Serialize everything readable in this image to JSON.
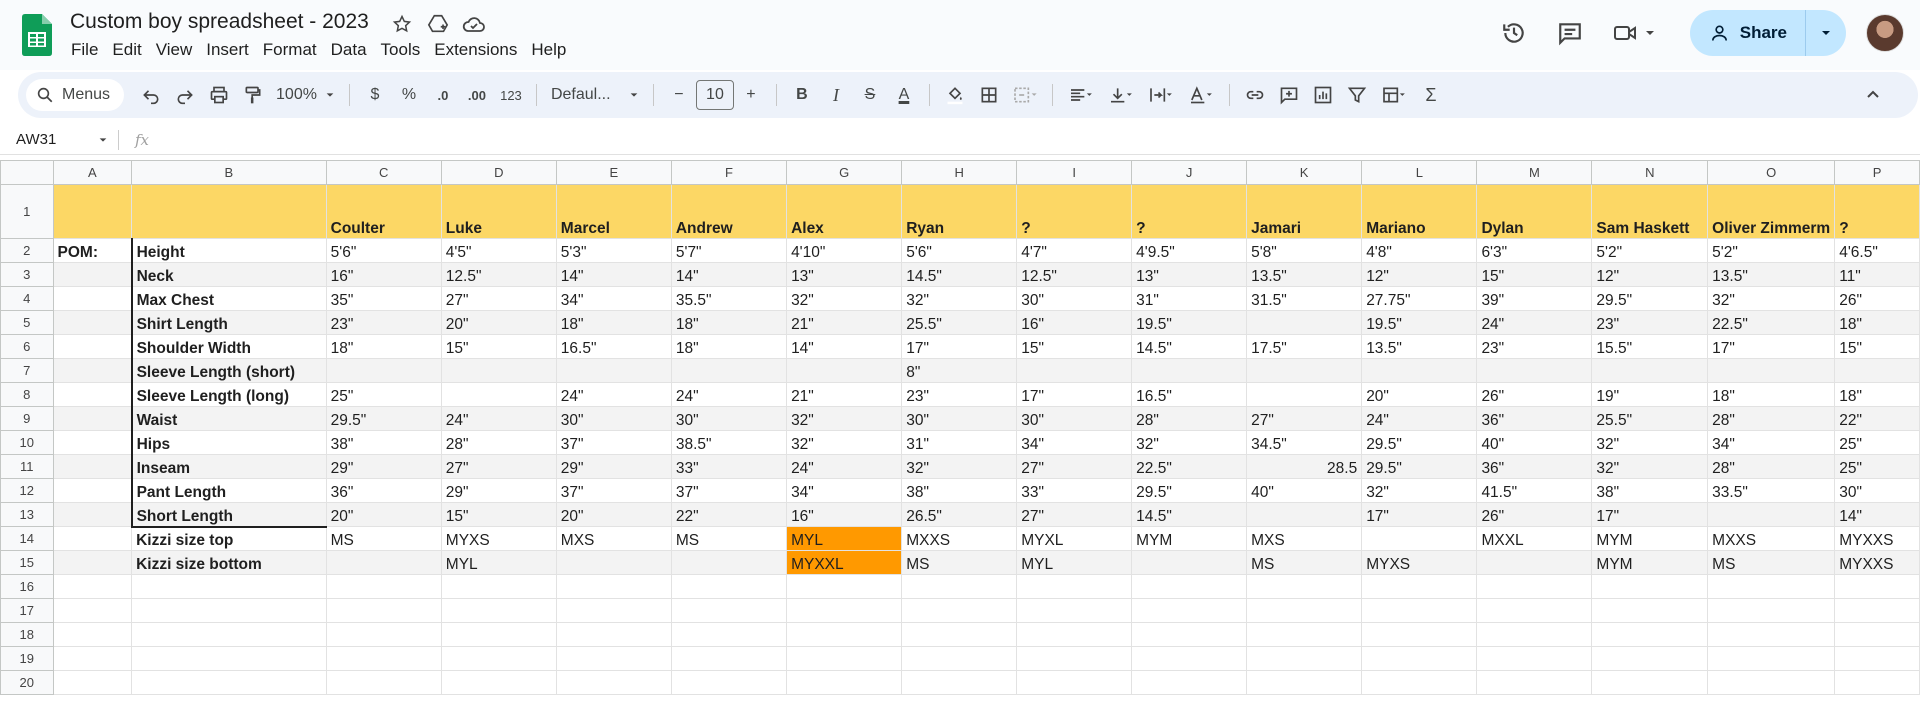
{
  "app": {
    "doc_title": "Custom boy spreadsheet - 2023",
    "menus": [
      "File",
      "Edit",
      "View",
      "Insert",
      "Format",
      "Data",
      "Tools",
      "Extensions",
      "Help"
    ],
    "share_label": "Share",
    "accent": "#c2e7ff"
  },
  "toolbar": {
    "search_label": "Menus",
    "zoom": "100%",
    "currency": "$",
    "percent": "%",
    "dec_decrease": ".0",
    "dec_increase": ".00",
    "number_format": "123",
    "font": "Defaul...",
    "font_size": "10",
    "minus": "−",
    "plus": "+",
    "bold": "B",
    "italic": "I",
    "strike": "S",
    "text_color": "A",
    "sigma": "Σ"
  },
  "formula_bar": {
    "name_box": "AW31",
    "fx": "fx"
  },
  "columns": [
    "A",
    "B",
    "C",
    "D",
    "E",
    "F",
    "G",
    "H",
    "I",
    "J",
    "K",
    "L",
    "M",
    "N",
    "O",
    "P"
  ],
  "rows": [
    [
      "",
      "",
      "Coulter",
      "Luke",
      "Marcel",
      "Andrew",
      "Alex",
      "Ryan",
      "?",
      "?",
      "Jamari",
      "Mariano",
      "Dylan",
      "Sam Haskett",
      "Oliver Zimmerm",
      "?"
    ],
    [
      "POM:",
      "Height",
      "5'6\"",
      "4'5\"",
      "5'3\"",
      "5'7\"",
      "4'10\"",
      "5'6\"",
      "4'7\"",
      "4'9.5\"",
      "5'8\"",
      "4'8\"",
      "6'3\"",
      "5'2\"",
      "5'2\"",
      "4'6.5\""
    ],
    [
      "",
      "Neck",
      "16\"",
      "12.5\"",
      "14\"",
      "14\"",
      "13\"",
      "14.5\"",
      "12.5\"",
      "13\"",
      "13.5\"",
      "12\"",
      "15\"",
      "12\"",
      "13.5\"",
      "11\""
    ],
    [
      "",
      "Max Chest",
      "35\"",
      "27\"",
      "34\"",
      "35.5\"",
      "32\"",
      "32\"",
      "30\"",
      "31\"",
      "31.5\"",
      "27.75\"",
      "39\"",
      "29.5\"",
      "32\"",
      "26\""
    ],
    [
      "",
      "Shirt Length",
      "23\"",
      "20\"",
      "18\"",
      "18\"",
      "21\"",
      "25.5\"",
      "16\"",
      "19.5\"",
      "",
      "19.5\"",
      "24\"",
      "23\"",
      "22.5\"",
      "18\""
    ],
    [
      "",
      "Shoulder Width",
      "18\"",
      "15\"",
      "16.5\"",
      "18\"",
      "14\"",
      "17\"",
      "15\"",
      "14.5\"",
      "17.5\"",
      "13.5\"",
      "23\"",
      "15.5\"",
      "17\"",
      "15\""
    ],
    [
      "",
      "Sleeve Length (short)",
      "",
      "",
      "",
      "",
      "",
      "8\"",
      "",
      "",
      "",
      "",
      "",
      "",
      "",
      ""
    ],
    [
      "",
      "Sleeve Length (long)",
      "25\"",
      "",
      "24\"",
      "24\"",
      "21\"",
      "23\"",
      "17\"",
      "16.5\"",
      "",
      "20\"",
      "26\"",
      "19\"",
      "18\"",
      "18\""
    ],
    [
      "",
      "Waist",
      "29.5\"",
      "24\"",
      "30\"",
      "30\"",
      "32\"",
      "30\"",
      "30\"",
      "28\"",
      "27\"",
      "24\"",
      "36\"",
      "25.5\"",
      "28\"",
      "22\""
    ],
    [
      "",
      "Hips",
      "38\"",
      "28\"",
      "37\"",
      "38.5\"",
      "32\"",
      "31\"",
      "34\"",
      "32\"",
      "34.5\"",
      "29.5\"",
      "40\"",
      "32\"",
      "34\"",
      "25\""
    ],
    [
      "",
      "Inseam",
      "29\"",
      "27\"",
      "29\"",
      "33\"",
      "24\"",
      "32\"",
      "27\"",
      "22.5\"",
      "28.5",
      "29.5\"",
      "36\"",
      "32\"",
      "28\"",
      "25\""
    ],
    [
      "",
      "Pant Length",
      "36\"",
      "29\"",
      "37\"",
      "37\"",
      "34\"",
      "38\"",
      "33\"",
      "29.5\"",
      "40\"",
      "32\"",
      "41.5\"",
      "38\"",
      "33.5\"",
      "30\""
    ],
    [
      "",
      "Short Length",
      "20\"",
      "15\"",
      "20\"",
      "22\"",
      "16\"",
      "26.5\"",
      "27\"",
      "14.5\"",
      "",
      "17\"",
      "26\"",
      "17\"",
      "",
      "14\""
    ],
    [
      "",
      "Kizzi size top",
      "MS",
      "MYXS",
      "MXS",
      "MS",
      "MYL",
      "MXXS",
      "MYXL",
      "MYM",
      "MXS",
      "",
      "MXXL",
      "MYM",
      "MXXS",
      "MYXXS"
    ],
    [
      "",
      "Kizzi size bottom",
      "",
      "MYL",
      "",
      "",
      "MYXXL",
      "MS",
      "MYL",
      "",
      "MS",
      "MYXS",
      "",
      "MYM",
      "MS",
      "MYXXS"
    ],
    [
      "",
      "",
      "",
      "",
      "",
      "",
      "",
      "",
      "",
      "",
      "",
      "",
      "",
      "",
      "",
      ""
    ],
    [
      "",
      "",
      "",
      "",
      "",
      "",
      "",
      "",
      "",
      "",
      "",
      "",
      "",
      "",
      "",
      ""
    ],
    [
      "",
      "",
      "",
      "",
      "",
      "",
      "",
      "",
      "",
      "",
      "",
      "",
      "",
      "",
      "",
      ""
    ],
    [
      "",
      "",
      "",
      "",
      "",
      "",
      "",
      "",
      "",
      "",
      "",
      "",
      "",
      "",
      "",
      ""
    ],
    [
      "",
      "",
      "",
      "",
      "",
      "",
      "",
      "",
      "",
      "",
      "",
      "",
      "",
      "",
      "",
      ""
    ]
  ],
  "colors": {
    "header_row": "#fcd765",
    "highlight": "#ff9900",
    "band": "#f3f3f3"
  }
}
